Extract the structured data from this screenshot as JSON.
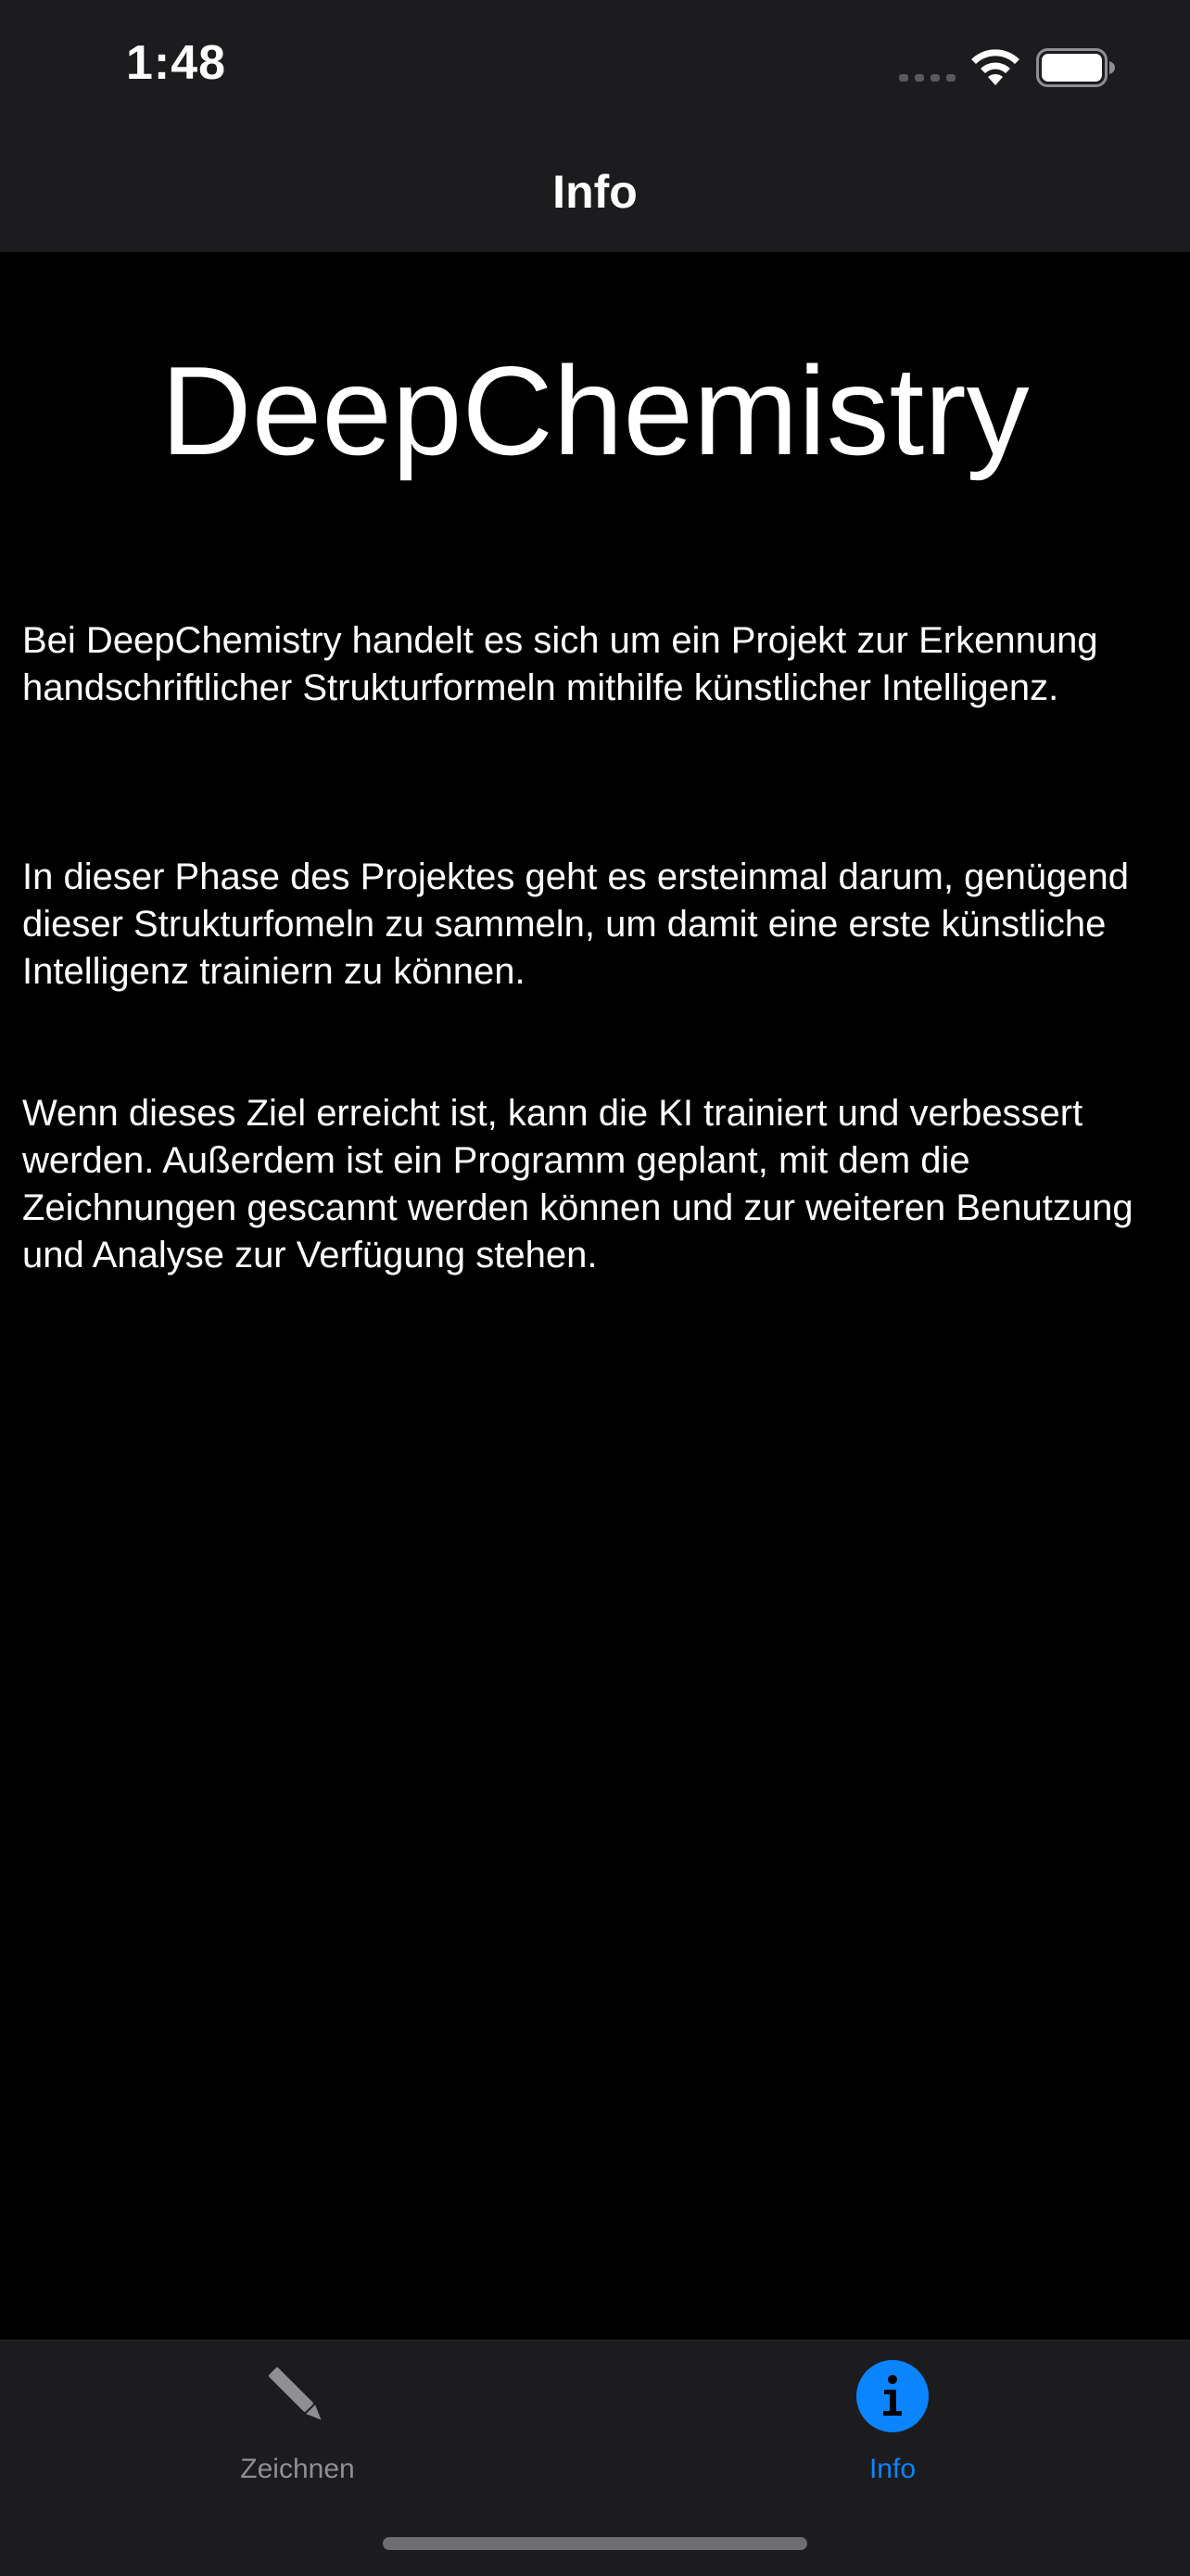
{
  "status_bar": {
    "time": "1:48",
    "icons": [
      "cellular-signal-icon",
      "wifi-icon",
      "battery-icon"
    ]
  },
  "nav_bar": {
    "title": "Info"
  },
  "main": {
    "app_title": "DeepChemistry",
    "paragraphs": [
      "Bei DeepChemistry handelt es sich um ein Projekt zur Erkennung handschriftlicher Strukturformeln mithilfe künstlicher Intelligenz.",
      "In dieser Phase des Projektes geht es ersteinmal darum, genügend dieser Strukturfomeln zu sammeln, um damit eine erste künstliche Intelligenz trainiern zu können.",
      "Wenn dieses Ziel erreicht ist, kann die KI trainiert und verbessert werden. Außerdem ist ein Programm geplant, mit dem die Zeichnungen gescannt werden können und zur weiteren Benutzung und Analyse zur Verfügung stehen."
    ]
  },
  "tab_bar": {
    "tabs": [
      {
        "label": "Zeichnen",
        "icon": "pencil-icon",
        "selected": false
      },
      {
        "label": "Info",
        "icon": "info-circle-icon",
        "selected": true
      }
    ]
  },
  "colors": {
    "background": "#000000",
    "chrome": "#1c1c1e",
    "accent": "#0a84ff",
    "inactive": "#8e8e93"
  }
}
